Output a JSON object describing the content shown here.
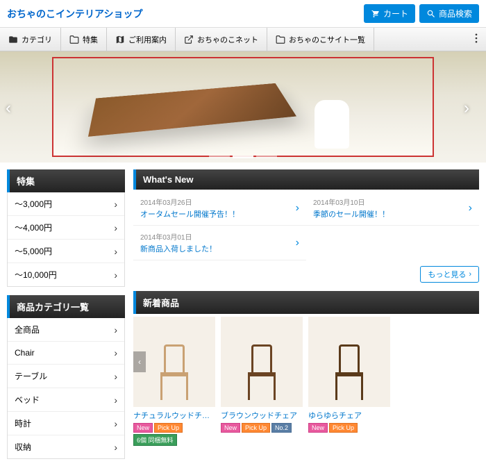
{
  "header": {
    "site_title": "おちゃのこインテリアショップ",
    "cart_label": "カート",
    "search_label": "商品検索"
  },
  "nav": {
    "items": [
      {
        "label": "カテゴリ"
      },
      {
        "label": "特集"
      },
      {
        "label": "ご利用案内"
      },
      {
        "label": "おちゃのこネット"
      },
      {
        "label": "おちゃのこサイト一覧"
      }
    ]
  },
  "sidebar": {
    "feature_title": "特集",
    "feature_items": [
      "〜3,000円",
      "〜4,000円",
      "〜5,000円",
      "〜10,000円"
    ],
    "category_title": "商品カテゴリ一覧",
    "category_items": [
      "全商品",
      "Chair",
      "テーブル",
      "ベッド",
      "時計",
      "収納"
    ]
  },
  "whatsnew": {
    "title": "What's New",
    "items": [
      {
        "date": "2014年03月26日",
        "title": "オータムセール開催予告！！"
      },
      {
        "date": "2014年03月10日",
        "title": "季節のセール開催！！"
      },
      {
        "date": "2014年03月01日",
        "title": "新商品入荷しました！"
      }
    ],
    "more_label": "もっと見る"
  },
  "new_arrivals": {
    "title": "新着商品",
    "products": [
      {
        "name": "ナチュラルウッドチェア",
        "badges": [
          "New",
          "Pick Up",
          "6個 同梱無料"
        ],
        "chair_color": "#c9a173"
      },
      {
        "name": "ブラウンウッドチェア",
        "badges": [
          "New",
          "Pick Up",
          "No.2"
        ],
        "chair_color": "#6b4423"
      },
      {
        "name": "ゆらゆらチェア",
        "badges": [
          "New",
          "Pick Up"
        ],
        "chair_color": "#5a3a1a"
      }
    ]
  }
}
